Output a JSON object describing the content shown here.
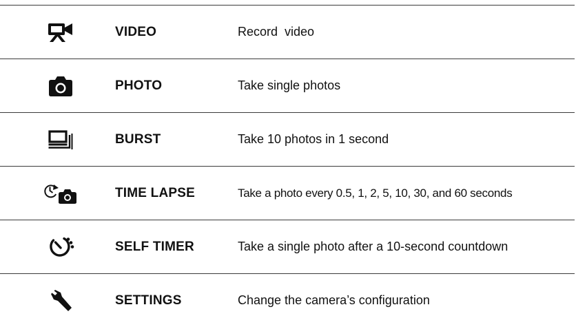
{
  "modes": [
    {
      "icon": "video-camera-icon",
      "name": "VIDEO",
      "description": "Record  video"
    },
    {
      "icon": "photo-camera-icon",
      "name": "PHOTO",
      "description": "Take single photos"
    },
    {
      "icon": "burst-icon",
      "name": "BURST",
      "description": "Take 10 photos in 1 second"
    },
    {
      "icon": "time-lapse-icon",
      "name": "TIME LAPSE",
      "description": "Take a photo every 0.5, 1, 2, 5, 10, 30, and 60 seconds"
    },
    {
      "icon": "self-timer-icon",
      "name": "SELF TIMER",
      "description": "Take a single photo after a 10-second countdown"
    },
    {
      "icon": "wrench-icon",
      "name": "SETTINGS",
      "description": "Change the camera’s configuration"
    }
  ]
}
